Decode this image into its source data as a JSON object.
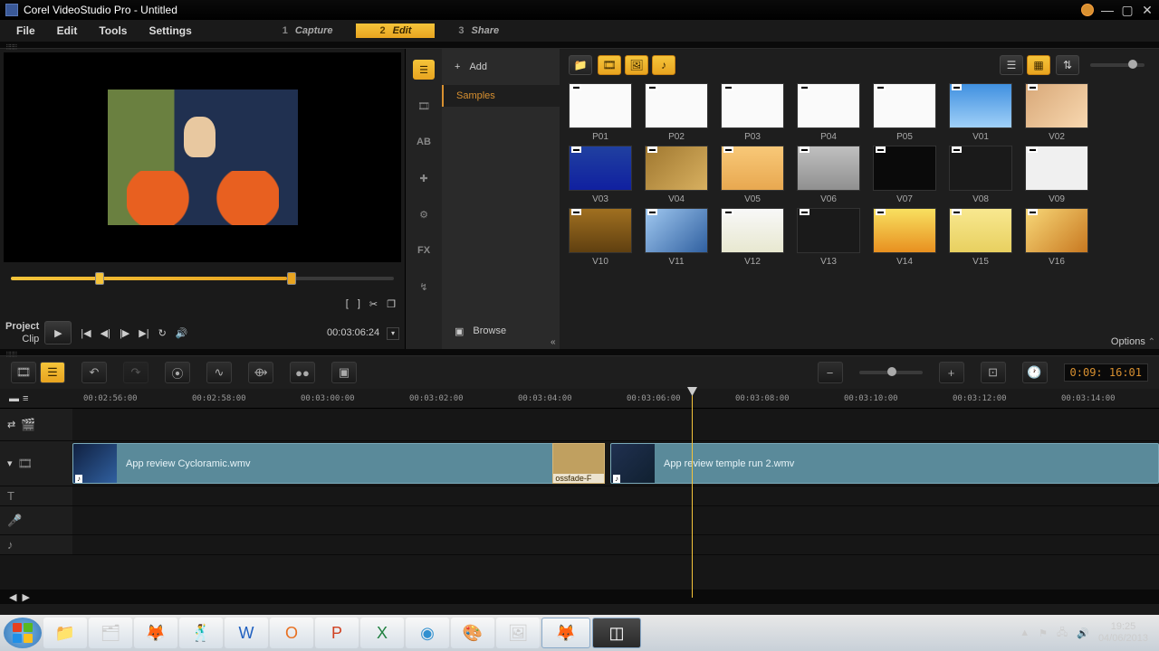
{
  "window": {
    "title": "Corel VideoStudio Pro - Untitled"
  },
  "menu": [
    "File",
    "Edit",
    "Tools",
    "Settings"
  ],
  "steps": [
    {
      "n": "1",
      "l": "Capture"
    },
    {
      "n": "2",
      "l": "Edit"
    },
    {
      "n": "3",
      "l": "Share"
    }
  ],
  "preview": {
    "project": "Project",
    "clip": "Clip",
    "timecode": "00:03:06:24"
  },
  "library": {
    "add": "Add",
    "samples": "Samples",
    "browse": "Browse",
    "options": "Options",
    "fx": "FX",
    "ab": "AB",
    "thumbs": [
      [
        "P01",
        "P02",
        "P03",
        "P04",
        "P05",
        "V01",
        "V02"
      ],
      [
        "V03",
        "V04",
        "V05",
        "V06",
        "V07",
        "V08",
        "V09"
      ],
      [
        "V10",
        "V11",
        "V12",
        "V13",
        "V14",
        "V15",
        "V16"
      ]
    ]
  },
  "timeline": {
    "duration": "0:09: 16:01",
    "ticks": [
      "00:02:56:00",
      "00:02:58:00",
      "00:03:00:00",
      "00:03:02:00",
      "00:03:04:00",
      "00:03:06:00",
      "00:03:08:00",
      "00:03:10:00",
      "00:03:12:00",
      "00:03:14:00"
    ],
    "clip1": "App review Cycloramic.wmv",
    "clip2": "App review temple run 2.wmv",
    "trans": "ossfade-F"
  },
  "taskbar": {
    "time": "19:25",
    "date": "04/06/2013"
  }
}
